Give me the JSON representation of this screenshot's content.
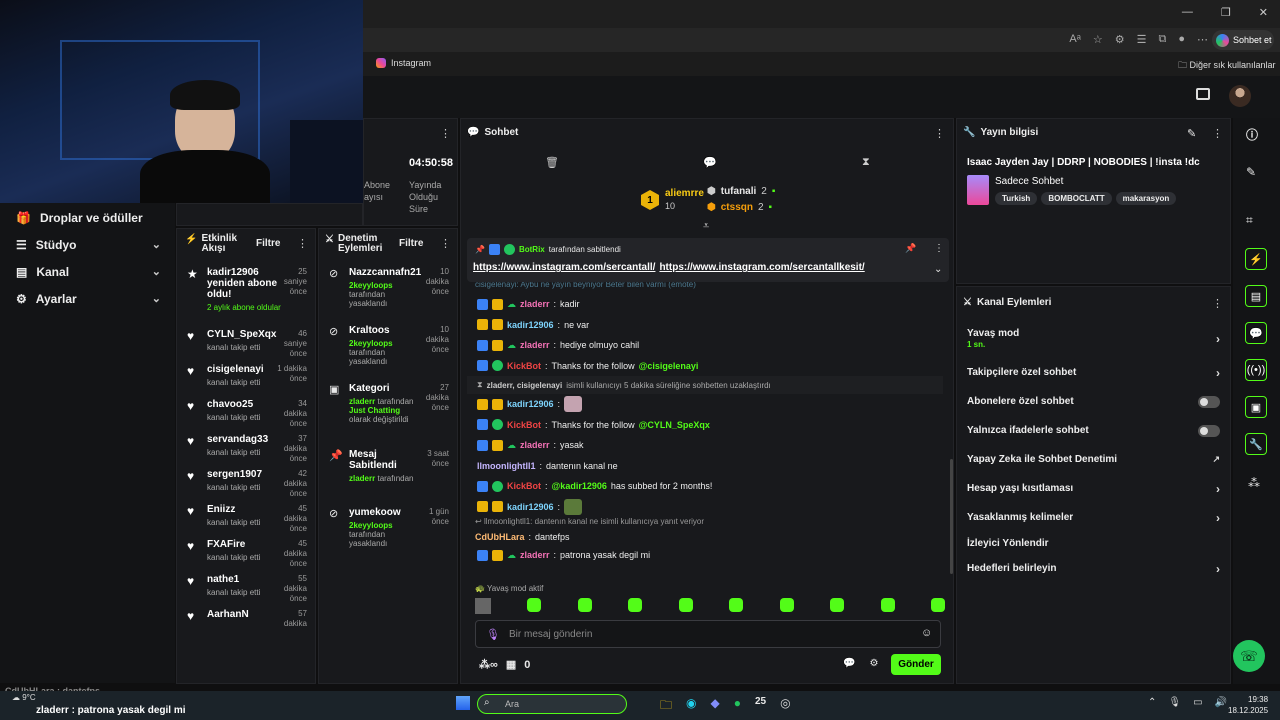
{
  "browser": {
    "window_controls": [
      "—",
      "❐",
      "✕"
    ],
    "chat_button": "Sohbet et",
    "fav_instagram": "Instagram",
    "fav_other": "Diğer sık kullanılanlar"
  },
  "sidebar": {
    "items": [
      {
        "label": "Droplar ve ödüller"
      },
      {
        "label": "Stüdyo"
      },
      {
        "label": "Kanal"
      },
      {
        "label": "Ayarlar"
      }
    ]
  },
  "stream_stats": {
    "time": "04:50:58",
    "abone_partial": "Abone",
    "ayisi_partial": "ayısı",
    "uptime_label1": "Yayında",
    "uptime_label2": "Olduğu",
    "uptime_label3": "Süre"
  },
  "activity": {
    "title1": "Etkinlik",
    "title2": "Akışı",
    "filter": "Filtre",
    "items": [
      {
        "name": "kadir12906 yeniden abone oldu!",
        "sub": "2 aylık abone oldular",
        "time": "25 saniye önce"
      },
      {
        "name": "CYLN_SpeXqx",
        "sub": "kanalı takip etti",
        "time": "46 saniye önce"
      },
      {
        "name": "cisigelenayi",
        "sub": "kanalı takip etti",
        "time": "1 dakika önce"
      },
      {
        "name": "chavoo25",
        "sub": "kanalı takip etti",
        "time": "34 dakika önce"
      },
      {
        "name": "servandag33",
        "sub": "kanalı takip etti",
        "time": "37 dakika önce"
      },
      {
        "name": "sergen1907",
        "sub": "kanalı takip etti",
        "time": "42 dakika önce"
      },
      {
        "name": "Eniizz",
        "sub": "kanalı takip etti",
        "time": "45 dakika önce"
      },
      {
        "name": "FXAFire",
        "sub": "kanalı takip etti",
        "time": "45 dakika önce"
      },
      {
        "name": "nathe1",
        "sub": "kanalı takip etti",
        "time": "55 dakika önce"
      },
      {
        "name": "AarhanN",
        "sub": "",
        "time": "57 dakika"
      }
    ]
  },
  "moderation": {
    "title1": "Denetim",
    "title2": "Eylemleri",
    "filter": "Filtre",
    "items": [
      {
        "name": "Nazzcannafn21",
        "time": "10 dakika önce",
        "actor": "2keyyloops",
        "rest": "tarafından yasaklandı"
      },
      {
        "name": "Kraltoos",
        "time": "10 dakika önce",
        "actor": "2keyyloops",
        "rest": "tarafından yasaklandı"
      },
      {
        "name": "Kategori",
        "time": "27 dakika önce",
        "actor": "zladerr",
        "rest": "tarafından",
        "extra": "Just Chatting",
        "rest2": "olarak değiştirildi"
      },
      {
        "name": "Mesaj Sabitlendi",
        "time": "3 saat önce",
        "actor": "zladerr",
        "rest": "tarafından"
      },
      {
        "name": "yumekoow",
        "time": "1 gün önce",
        "actor": "2keyyloops",
        "rest": "tarafından yasaklandı"
      }
    ]
  },
  "chat": {
    "title": "Sohbet",
    "gifter1": "aliemrre",
    "gifter1_count": "10",
    "gifter1_rank": "1",
    "gifter2": "tufanali",
    "gifter2_count": "2",
    "gifter3": "ctssqn",
    "gifter3_count": "2",
    "pinned_by": "BotRix",
    "pinned_suffix": "tarafından sabitlendi",
    "pinned_link1": "https://www.instagram.com/sercantall/",
    "pinned_link2": "https://www.instagram.com/sercantallkesit/",
    "cut_line": "cisigelenayi: Aybu ne yayın beyniyor Beter bilen varmı (emote)",
    "messages": [
      {
        "user": "zladerr",
        "color": "#f472b6",
        "text": "kadir"
      },
      {
        "user": "kadir12906",
        "color": "#7dd3fc",
        "text": "ne var"
      },
      {
        "user": "zladerr",
        "color": "#f472b6",
        "text": "hediye olmuyo cahil"
      },
      {
        "user": "KickBot",
        "color": "#ef4444",
        "text": "Thanks for the follow",
        "mention": "@cisigelenayi"
      }
    ],
    "system1_users": "zladerr, cisigelenayi",
    "system1_text": "isimli kullanıcıyı 5 dakika süreliğine sohbetten uzaklaştırdı",
    "messages2": [
      {
        "user": "kadir12906",
        "color": "#7dd3fc",
        "text": ""
      },
      {
        "user": "KickBot",
        "color": "#ef4444",
        "text": "Thanks for the follow",
        "mention": "@CYLN_SpeXqx"
      },
      {
        "user": "zladerr",
        "color": "#f472b6",
        "text": "yasak"
      },
      {
        "user": "llmoonlightll1",
        "color": "#c4b5fd",
        "text": "dantenın kanal ne"
      },
      {
        "user": "KickBot",
        "color": "#ef4444",
        "text": "has subbed for 2 months!",
        "mention": "@kadir12906"
      },
      {
        "user": "kadir12906",
        "color": "#7dd3fc",
        "text": ""
      }
    ],
    "reply_ref": "llmoonlightll1: dantenın kanal ne isimli kullanıcıya yanıt veriyor",
    "reply_user": "CdUbHLara",
    "reply_text": "dantefps",
    "last_user": "zladerr",
    "last_text": "patrona yasak degil mi",
    "slow_mode": "Yavaş mod aktif",
    "input_placeholder": "Bir mesaj gönderin",
    "points": "0",
    "send": "Gönder"
  },
  "stream_info": {
    "title": "Yayın bilgisi",
    "stream_title": "Isaac Jayden Jay | DDRP | NOBODIES | !insta !dc",
    "category": "Sadece Sohbet",
    "tags": [
      "Turkish",
      "BOMBOCLATT",
      "makarasyon"
    ]
  },
  "channel_actions": {
    "title": "Kanal Eylemleri",
    "slow": "Yavaş mod",
    "slow_val": "1 sn.",
    "followers": "Takipçilere özel sohbet",
    "subs": "Abonelere özel sohbet",
    "emotes": "Yalnızca ifadelerle sohbet",
    "ai": "Yapay Zeka ile Sohbet Denetimi",
    "age": "Hesap yaşı kısıtlaması",
    "banned": "Yasaklanmış kelimeler",
    "redirect": "İzleyici Yönlendir",
    "goals": "Hedefleri belirleyin"
  },
  "overlay": {
    "line1": "CdUbHLara : dantefps",
    "line2": "zladerr : patrona yasak degil mi",
    "temp": "9°C"
  },
  "taskbar": {
    "search": "Ara",
    "time": "19:38",
    "date": "18.12.2025",
    "badge": "25"
  },
  "colors": {
    "accent": "#53fc18"
  }
}
